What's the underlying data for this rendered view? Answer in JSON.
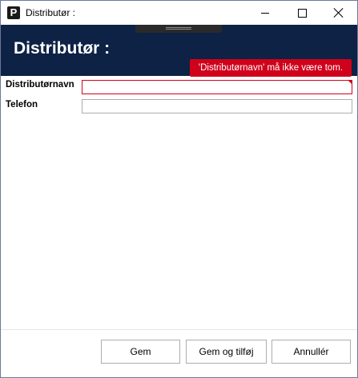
{
  "window": {
    "title": "Distributør :",
    "icon_letter": "P"
  },
  "header": {
    "title": "Distributør :"
  },
  "validation": {
    "message": "'Distributørnavn' må ikke være tom."
  },
  "form": {
    "name_label": "Distributørnavn",
    "name_value": "",
    "phone_label": "Telefon",
    "phone_value": ""
  },
  "footer": {
    "save_label": "Gem",
    "save_add_label": "Gem og tilføj",
    "cancel_label": "Annullér"
  },
  "colors": {
    "header_bg": "#0d2244",
    "error": "#d0021b"
  }
}
